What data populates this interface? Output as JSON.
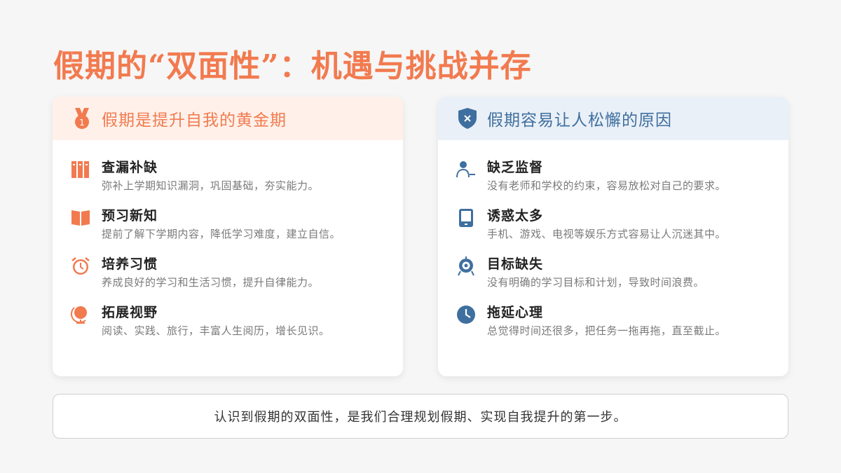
{
  "title": "假期的“双面性”：机遇与挑战并存",
  "left_card": {
    "header": "假期是提升自我的黄金期",
    "header_icon": "medal-icon",
    "accent": "#f27a4f",
    "items": [
      {
        "title": "查漏补缺",
        "desc": "弥补上学期知识漏洞，巩固基础，夯实能力。",
        "icon": "books-icon"
      },
      {
        "title": "预习新知",
        "desc": "提前了解下学期内容，降低学习难度，建立自信。",
        "icon": "open-book-icon"
      },
      {
        "title": "培养习惯",
        "desc": "养成良好的学习和生活习惯，提升自律能力。",
        "icon": "alarm-clock-icon"
      },
      {
        "title": "拓展视野",
        "desc": "阅读、实践、旅行，丰富人生阅历，增长见识。",
        "icon": "globe-icon"
      }
    ]
  },
  "right_card": {
    "header": "假期容易让人松懈的原因",
    "header_icon": "shield-x-icon",
    "accent": "#3f6f9f",
    "items": [
      {
        "title": "缺乏监督",
        "desc": "没有老师和学校的约束，容易放松对自己的要求。",
        "icon": "user-minus-icon"
      },
      {
        "title": "诱惑太多",
        "desc": "手机、游戏、电视等娱乐方式容易让人沉迷其中。",
        "icon": "tablet-icon"
      },
      {
        "title": "目标缺失",
        "desc": "没有明确的学习目标和计划，导致时间浪费。",
        "icon": "compass-target-icon"
      },
      {
        "title": "拖延心理",
        "desc": "总觉得时间还很多，把任务一拖再拖，直至截止。",
        "icon": "clock-icon"
      }
    ]
  },
  "footer": "认识到假期的双面性，是我们合理规划假期、实现自我提升的第一步。"
}
